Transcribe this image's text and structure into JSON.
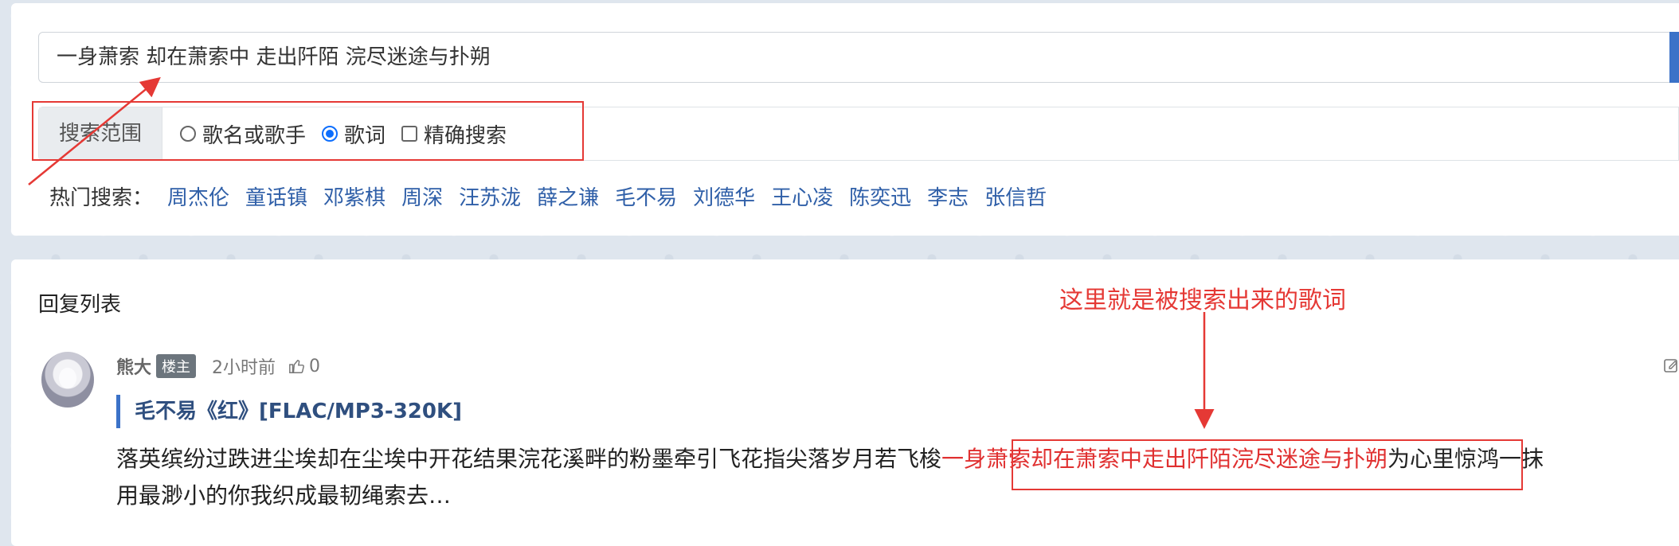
{
  "search": {
    "query": "一身萧索 却在萧索中 走出阡陌 浣尽迷途与扑朔"
  },
  "scope": {
    "label": "搜索范围",
    "options": [
      {
        "label": "歌名或歌手",
        "checked": false
      },
      {
        "label": "歌词",
        "checked": true
      },
      {
        "label": "精确搜索",
        "checked": false
      }
    ]
  },
  "hot": {
    "label": "热门搜索：",
    "items": [
      "周杰伦",
      "童话镇",
      "邓紫棋",
      "周深",
      "汪苏泷",
      "薛之谦",
      "毛不易",
      "刘德华",
      "王心凌",
      "陈奕迅",
      "李志",
      "张信哲"
    ]
  },
  "replies": {
    "title": "回复列表",
    "post": {
      "author": "熊大",
      "badge": "楼主",
      "time": "2小时前",
      "likes": "0",
      "thread_title": "毛不易《红》[FLAC/MP3-320K]",
      "lyrics_before": "落英缤纷过跌进尘埃却在尘埃中开花结果浣花溪畔的粉墨牵引飞花指尖落岁月若飞梭",
      "lyrics_highlight": "一身萧索却在萧索中走出阡陌浣尽迷途与扑朔",
      "lyrics_after": "为心里惊鸿一抹",
      "lyrics_line2": "用最渺小的你我织成最韧绳索去…"
    }
  },
  "annotation": {
    "text": "这里就是被搜索出来的歌词",
    "color": "#e53935"
  },
  "colors": {
    "link": "#2f5fa8",
    "accent": "#3b72c8",
    "highlight": "#e03030"
  }
}
